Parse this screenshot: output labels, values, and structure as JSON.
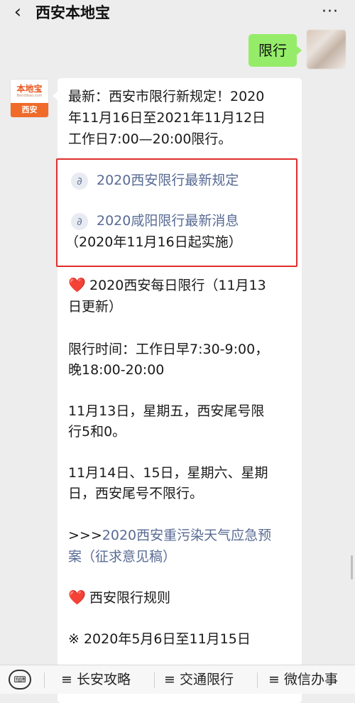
{
  "header": {
    "back_icon": "chevron-left-icon",
    "title": "西安本地宝",
    "more_icon": "more-dots-icon"
  },
  "outgoing": {
    "text": "限行"
  },
  "sender": {
    "logo_brand": "本地宝",
    "logo_sub": "Bendibao.com",
    "logo_city": "西安"
  },
  "message": {
    "intro_lines": [
      "最新：西安市限行新规定！2020",
      "年11月16日至2021年11月12日",
      "工作日7:00—20:00限行。"
    ],
    "link1": "2020西安限行最新规定",
    "link2": "2020咸阳限行最新消息",
    "link2_note": "（2020年11月16日起实施）",
    "daily_title_lines": [
      "2020西安每日限行（11月13",
      "日更新）"
    ],
    "time_lines": [
      "限行时间：工作日早7:30-9:00，",
      "晚18:00-20:00"
    ],
    "nov13_lines": [
      "11月13日，星期五，西安尾号限",
      "行5和0。"
    ],
    "nov14_lines": [
      "11月14日、15日，星期六、星期",
      "日，西安尾号不限行。"
    ],
    "emergency_prefix": ">>>",
    "emergency_link_lines": [
      "2020西安重污染天气应急预",
      "案（征求意见稿）"
    ],
    "rules_title": "西安限行规则",
    "date_line": "※ 2020年5月6日至11月15日"
  },
  "bottombar": {
    "keyboard_icon": "keyboard-icon",
    "tabs": [
      "≡ 长安攻略",
      "≡ 交通限行",
      "≡ 微信办事"
    ]
  },
  "colors": {
    "bubble_green": "#95ec69",
    "link": "#586b94",
    "highlight_border": "#e02d2d"
  }
}
